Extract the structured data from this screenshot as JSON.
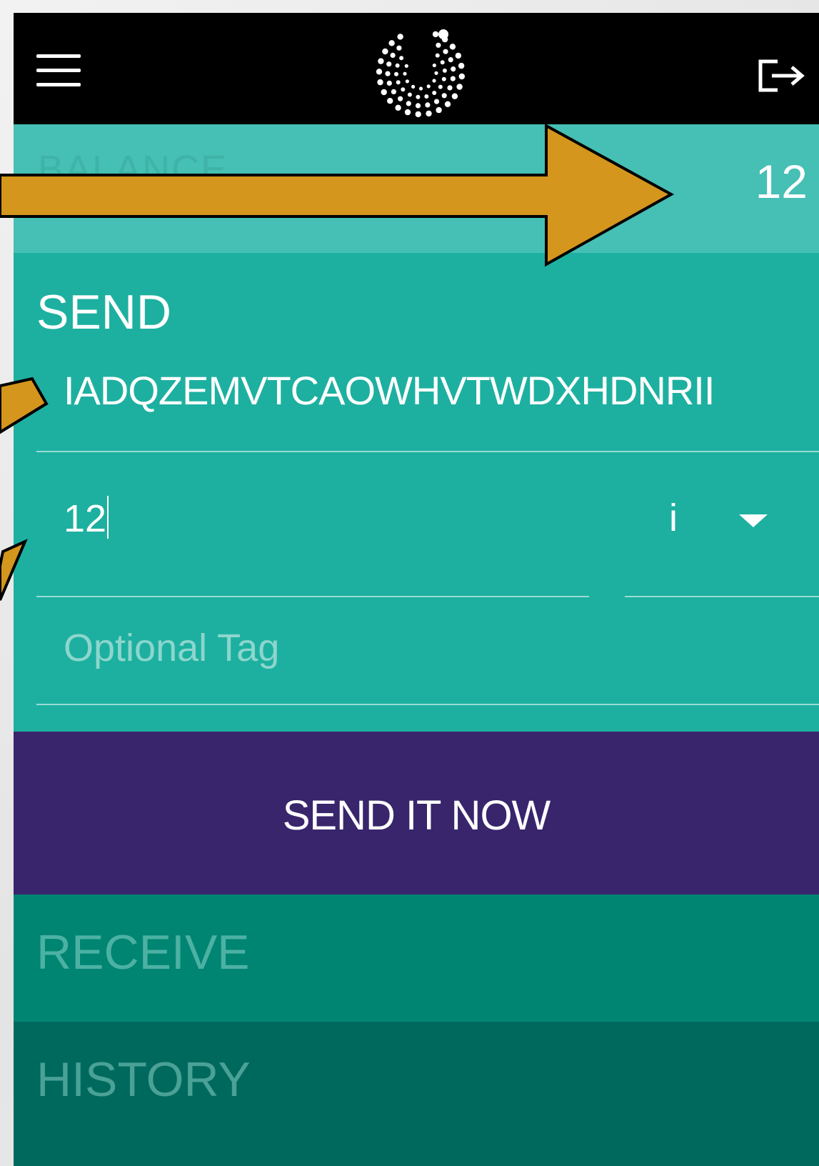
{
  "header": {
    "menu_icon": "hamburger-menu-icon",
    "logo_icon": "iota-logo-icon",
    "logout_icon": "logout-icon"
  },
  "balance": {
    "label": "BALANCE",
    "value": "12"
  },
  "send": {
    "title": "SEND",
    "address_value": "IADQZEMVTCAOWHVTWDXHDNRII",
    "amount_value": "12",
    "unit_value": "i",
    "tag_placeholder": "Optional Tag",
    "button_label": "SEND IT NOW"
  },
  "receive": {
    "label": "RECEIVE"
  },
  "history": {
    "label": "HISTORY"
  },
  "colors": {
    "header_bg": "#000000",
    "balance_bg": "#46bfb4",
    "send_bg": "#1db0a0",
    "send_button_bg": "#38256c",
    "receive_bg": "#008573",
    "history_bg": "#00695d",
    "annotation_arrow": "#d4961c"
  }
}
